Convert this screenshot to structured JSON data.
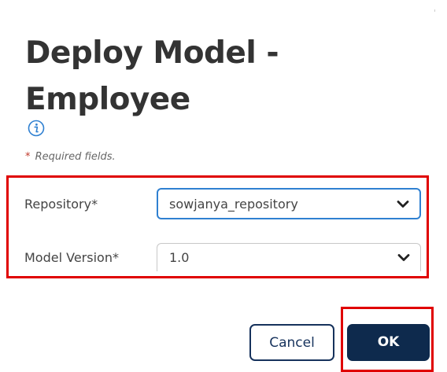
{
  "dialog": {
    "title": "Deploy Model - Employee",
    "info_icon": "info-icon",
    "required_note_star": "*",
    "required_note_text": "Required fields."
  },
  "form": {
    "repository": {
      "label": "Repository*",
      "value": "sowjanya_repository",
      "icon": "chevron-down-icon"
    },
    "model_version": {
      "label": "Model Version*",
      "value": "1.0",
      "icon": "chevron-down-icon"
    }
  },
  "buttons": {
    "cancel_label": "Cancel",
    "ok_label": "OK"
  },
  "colors": {
    "highlight": "#e00000",
    "primary": "#0e2a4d",
    "focus_border": "#2f80d1",
    "info_icon": "#2f80d1"
  }
}
